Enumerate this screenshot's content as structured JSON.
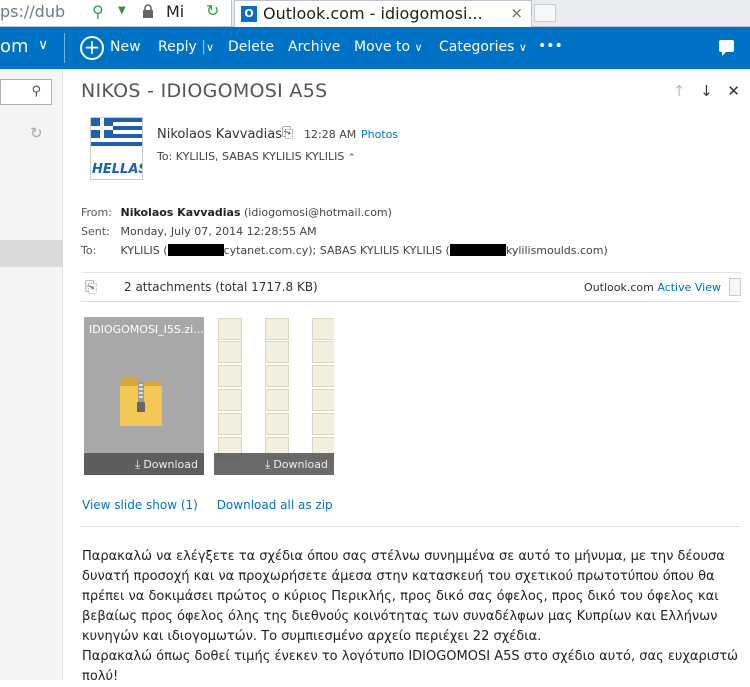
{
  "browser": {
    "url_fragment": "ps://dub",
    "site_fragment": "Mi",
    "tab_title": "Outlook.com - idiogomosi...",
    "tab_close": "×"
  },
  "toolbar": {
    "brand": "om",
    "new_label": "New",
    "reply_label": "Reply",
    "delete_label": "Delete",
    "archive_label": "Archive",
    "move_label": "Move to",
    "categories_label": "Categories",
    "more_label": "•••"
  },
  "message": {
    "subject": "NIKOS - IDIOGOMOSI A5S",
    "sender_name": "Nikolaos Kavvadias",
    "time": "12:28 AM",
    "photos_link": "Photos",
    "to_summary": "To: KYLILIS, SABAS KYLILIS KYLILIS",
    "avatar_text": "HELLAS",
    "from_label": "From:",
    "from_name": "Nikolaos Kavvadias",
    "from_email": "(idiogomosi@hotmail.com)",
    "sent_label": "Sent:",
    "sent_value": "Monday, July 07, 2014 12:28:55 AM",
    "to_label": "To:",
    "to_part1": "KYLILIS (",
    "to_part2": "cytanet.com.cy); SABAS KYLILIS KYLILIS (",
    "to_part3": "kylilismoulds.com)"
  },
  "attachments": {
    "summary": "2 attachments (total 1717.8 KB)",
    "viewer_prefix": "Outlook.com",
    "viewer_link": "Active View",
    "items": [
      {
        "filename": "IDIOGOMOSI_I5S.zi...",
        "download_label": "Download"
      },
      {
        "download_label": "Download"
      }
    ],
    "slideshow_link": "View slide show (1)",
    "zip_link": "Download all as zip"
  },
  "body": {
    "paragraph1": "Παρακαλώ να ελέγξετε τα σχέδια όπου σας στέλνω συνημμένα σε αυτό το μήνυμα, με την δέουσα δυνατή προσοχή και να προχωρήσετε άμεσα στην κατασκευή του σχετικού πρωτοτύπου όπου θα πρέπει να δοκιμάσει πρώτος ο κύριος Περικλής, προς δικό σας όφελος, προς δικό του όφελος και βεβαίως προς όφελος όλης της διεθνούς κοινότητας των συναδέλφων μας Κυπρίων και Ελλήνων κυνηγών και ιδιογομωτών. Το συμπιεσμένο αρχείο περιέχει 22 σχέδια.",
    "paragraph2": "Παρακαλώ όπως δοθεί τιμής ένεκεν το λογότυπο IDIOGOMOSI A5S στο σχέδιο αυτό, σας ευχαριστώ πολύ!"
  },
  "colors": {
    "accent": "#0072c6",
    "link": "#0072c6"
  }
}
